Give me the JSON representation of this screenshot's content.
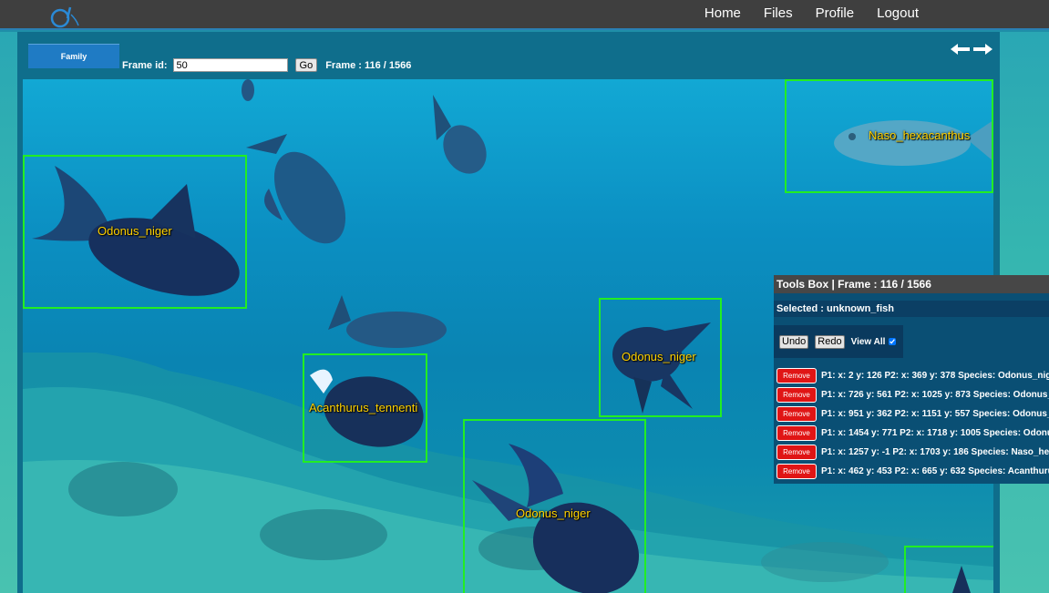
{
  "nav": {
    "logo": "logo-icon",
    "links": [
      "Home",
      "Files",
      "Profile",
      "Logout"
    ]
  },
  "controls": {
    "family_label": "Family",
    "frame_id_label": "Frame id:",
    "frame_id_value": "50",
    "go_label": "Go",
    "frame_counter": "Frame : 116 / 1566",
    "prev_icon": "arrow-left-icon",
    "next_icon": "arrow-right-icon"
  },
  "annotations_on_image": [
    {
      "species": "Odonus_niger"
    },
    {
      "species": "Naso_hexacanthus"
    },
    {
      "species": "Acanthurus_tennenti"
    },
    {
      "species": "Odonus_niger"
    },
    {
      "species": "Odonus_niger"
    }
  ],
  "tools_box": {
    "title": "Tools Box | Frame : 116 / 1566",
    "selected": "Selected : unknown_fish",
    "undo_label": "Undo",
    "redo_label": "Redo",
    "view_all_label": "View All",
    "view_all_checked": true,
    "remove_label": "Remove",
    "entries": [
      "P1: x: 2 y: 126 P2: x: 369 y: 378 Species: Odonus_niger",
      "P1: x: 726 y: 561 P2: x: 1025 y: 873 Species: Odonus_niger",
      "P1: x: 951 y: 362 P2: x: 1151 y: 557 Species: Odonus_niger",
      "P1: x: 1454 y: 771 P2: x: 1718 y: 1005 Species: Odonus_niger",
      "P1: x: 1257 y: -1 P2: x: 1703 y: 186 Species: Naso_hexacanthus",
      "P1: x: 462 y: 453 P2: x: 665 y: 632 Species: Acanthurus_tennenti"
    ]
  },
  "colors": {
    "navbar": "#3f3f3f",
    "bbox": "#22ee22",
    "label": "#ffd200",
    "remove": "#e01515"
  }
}
